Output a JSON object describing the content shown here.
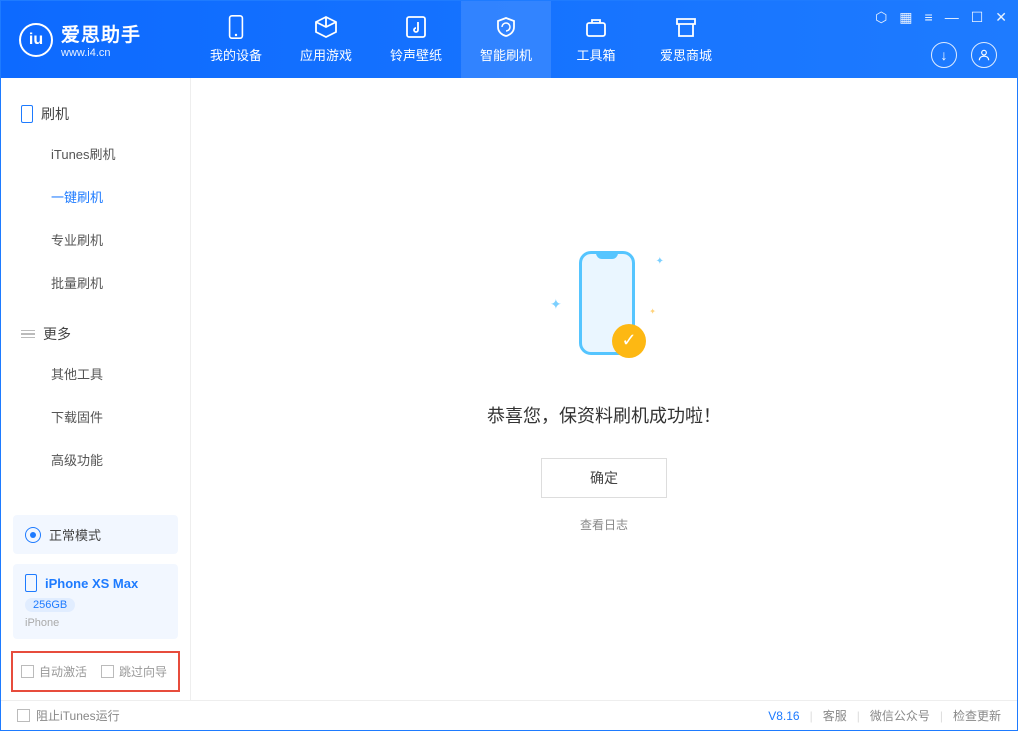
{
  "app": {
    "name": "爱思助手",
    "url": "www.i4.cn"
  },
  "nav": {
    "items": [
      {
        "label": "我的设备"
      },
      {
        "label": "应用游戏"
      },
      {
        "label": "铃声壁纸"
      },
      {
        "label": "智能刷机"
      },
      {
        "label": "工具箱"
      },
      {
        "label": "爱思商城"
      }
    ]
  },
  "sidebar": {
    "section_flash": "刷机",
    "flash_items": [
      "iTunes刷机",
      "一键刷机",
      "专业刷机",
      "批量刷机"
    ],
    "section_more": "更多",
    "more_items": [
      "其他工具",
      "下载固件",
      "高级功能"
    ],
    "mode": "正常模式",
    "device_name": "iPhone XS Max",
    "device_capacity": "256GB",
    "device_subtype": "iPhone",
    "checkbox_auto_activate": "自动激活",
    "checkbox_skip_guide": "跳过向导"
  },
  "main": {
    "success_msg": "恭喜您，保资料刷机成功啦！",
    "confirm": "确定",
    "view_log": "查看日志"
  },
  "footer": {
    "block_itunes": "阻止iTunes运行",
    "version": "V8.16",
    "links": [
      "客服",
      "微信公众号",
      "检查更新"
    ]
  }
}
